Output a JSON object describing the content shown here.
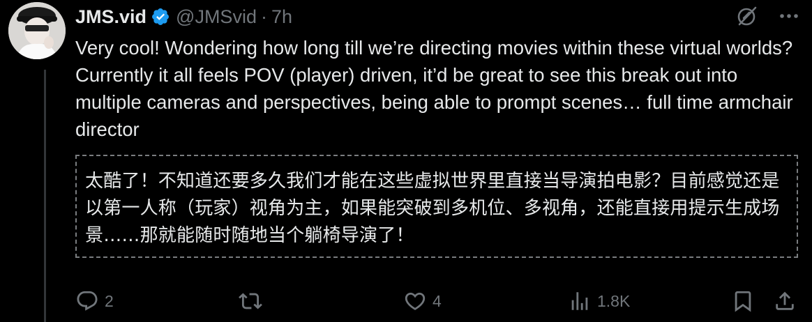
{
  "author": {
    "display_name": "JMS.vid",
    "handle": "@JMSvid",
    "separator": "·",
    "time": "7h",
    "verified": true
  },
  "tweet": {
    "text": "Very cool! Wondering how long till we’re directing movies within these virtual worlds? Currently it all feels POV (player) driven, it’d be great to see this break out into multiple cameras and perspectives, being able to prompt scenes… full time armchair director",
    "translation": "太酷了！不知道还要多久我们才能在这些虚拟世界里直接当导演拍电影？目前感觉还是以第一人称（玩家）视角为主，如果能突破到多机位、多视角，还能直接用提示生成场景……那就能随时随地当个躺椅导演了！"
  },
  "actions": {
    "replies": "2",
    "reposts": "",
    "likes": "4",
    "views": "1.8K"
  },
  "icons": {
    "verified": "verified-badge-icon",
    "grok": "grok-icon",
    "more": "more-icon",
    "reply": "reply-icon",
    "repost": "repost-icon",
    "like": "heart-icon",
    "views": "views-icon",
    "bookmark": "bookmark-icon",
    "share": "share-icon"
  },
  "colors": {
    "background": "#000000",
    "text_primary": "#e7e9ea",
    "text_secondary": "#71767b",
    "verified_blue": "#1d9bf0",
    "thread_line": "#333639"
  }
}
